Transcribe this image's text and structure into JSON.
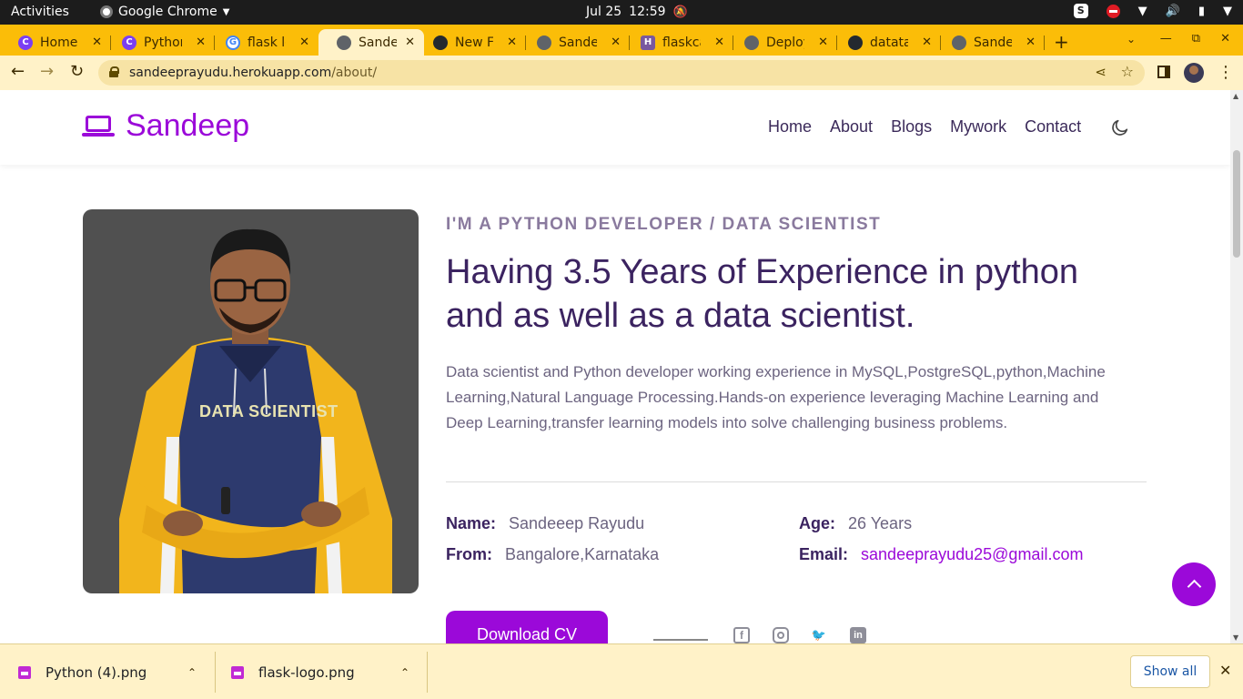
{
  "system_bar": {
    "activities": "Activities",
    "app_name": "Google Chrome",
    "date": "Jul 25",
    "time": "12:59"
  },
  "tabs": [
    {
      "title": "Home -",
      "favicon": "circle-c-icon",
      "active": false
    },
    {
      "title": "Python",
      "favicon": "circle-c-icon",
      "active": false
    },
    {
      "title": "flask lo",
      "favicon": "google-icon",
      "active": false
    },
    {
      "title": "Sandee",
      "favicon": "globe-icon",
      "active": true
    },
    {
      "title": "New Fil",
      "favicon": "github-icon",
      "active": false
    },
    {
      "title": "Sandee",
      "favicon": "globe-icon",
      "active": false
    },
    {
      "title": "flaskca",
      "favicon": "heroku-icon",
      "active": false
    },
    {
      "title": "Deploy",
      "favicon": "globe-icon",
      "active": false
    },
    {
      "title": "datatal",
      "favicon": "github-icon",
      "active": false
    },
    {
      "title": "Sandee",
      "favicon": "globe-icon",
      "active": false
    }
  ],
  "omnibox": {
    "host": "sandeeprayudu.herokuapp.com",
    "path": "/about/"
  },
  "site": {
    "brand": "Sandeep",
    "nav": [
      "Home",
      "About",
      "Blogs",
      "Mywork",
      "Contact"
    ],
    "accent": "#9b09d9"
  },
  "about": {
    "kicker": "I'M A PYTHON DEVELOPER / DATA SCIENTIST",
    "headline": "Having 3.5 Years of Experience in python and as well as a data scientist.",
    "bio": "Data scientist and Python developer working experience in MySQL,PostgreSQL,python,Machine Learning,Natural Language Processing.Hands-on experience leveraging  Machine Learning and Deep Learning,transfer learning models into solve challenging business problems.",
    "photo_text": "DATA SCIENTIST",
    "name_label": "Name:",
    "name_value": "Sandeeep Rayudu",
    "age_label": "Age:",
    "age_value": "26 Years",
    "from_label": "From:",
    "from_value": "Bangalore,Karnataka",
    "email_label": "Email:",
    "email_value": "sandeeprayudu25@gmail.com",
    "cv_button": "Download CV"
  },
  "downloads": {
    "items": [
      "Python (4).png",
      "flask-logo.png"
    ],
    "show_all": "Show all"
  }
}
